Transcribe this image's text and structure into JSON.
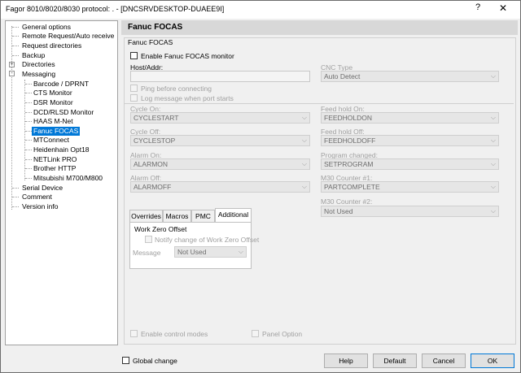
{
  "window": {
    "title": "Fagor 8010/8020/8030 protocol: . - [DNCSRVDESKTOP-DUAEE9I]",
    "help_glyph": "?",
    "close_glyph": "✕"
  },
  "tree": {
    "items": [
      {
        "label": "General options"
      },
      {
        "label": "Remote Request/Auto receive"
      },
      {
        "label": "Request directories"
      },
      {
        "label": "Backup"
      },
      {
        "label": "Directories"
      },
      {
        "label": "Messaging"
      },
      {
        "label": "Barcode / DPRNT"
      },
      {
        "label": "CTS Monitor"
      },
      {
        "label": "DSR Monitor"
      },
      {
        "label": "DCD/RLSD Monitor"
      },
      {
        "label": "HAAS M-Net"
      },
      {
        "label": "Fanuc FOCAS"
      },
      {
        "label": "MTConnect"
      },
      {
        "label": "Heidenhain Opt18"
      },
      {
        "label": "NETLink PRO"
      },
      {
        "label": "Brother HTTP"
      },
      {
        "label": "Mitsubishi M700/M800"
      },
      {
        "label": "Serial Device"
      },
      {
        "label": "Comment"
      },
      {
        "label": "Version info"
      }
    ],
    "plus": "+",
    "minus": "-"
  },
  "panel": {
    "header": "Fanuc FOCAS",
    "group_title": "Fanuc FOCAS",
    "enable_monitor": "Enable Fanuc FOCAS monitor",
    "host_label": "Host/Addr:",
    "cnc_type_label": "CNC Type",
    "cnc_type_value": "Auto Detect",
    "ping": "Ping before connecting",
    "log_msg": "Log message when port starts",
    "cycle_on_label": "Cycle On:",
    "cycle_on_value": "CYCLESTART",
    "feed_hold_on_label": "Feed hold On:",
    "feed_hold_on_value": "FEEDHOLDON",
    "cycle_off_label": "Cycle Off:",
    "cycle_off_value": "CYCLESTOP",
    "feed_hold_off_label": "Feed hold Off:",
    "feed_hold_off_value": "FEEDHOLDOFF",
    "alarm_on_label": "Alarm On:",
    "alarm_on_value": "ALARMON",
    "program_changed_label": "Program changed:",
    "program_changed_value": "SETPROGRAM",
    "alarm_off_label": "Alarm Off:",
    "alarm_off_value": "ALARMOFF",
    "m30_1_label": "M30 Counter #1:",
    "m30_1_value": "PARTCOMPLETE",
    "m30_2_label": "M30 Counter #2:",
    "m30_2_value": "Not Used",
    "tabs": [
      {
        "label": "Overrides"
      },
      {
        "label": "Macros"
      },
      {
        "label": "PMC"
      },
      {
        "label": "Additional"
      }
    ],
    "wzo_title": "Work Zero Offset",
    "wzo_notify": "Notify change of Work Zero Offset",
    "message_label": "Message",
    "message_value": "Not Used",
    "enable_control": "Enable control modes",
    "panel_option": "Panel Option",
    "arrow": "⌵"
  },
  "footer": {
    "global_change": "Global change",
    "help": "Help",
    "default": "Default",
    "cancel": "Cancel",
    "ok": "OK"
  }
}
